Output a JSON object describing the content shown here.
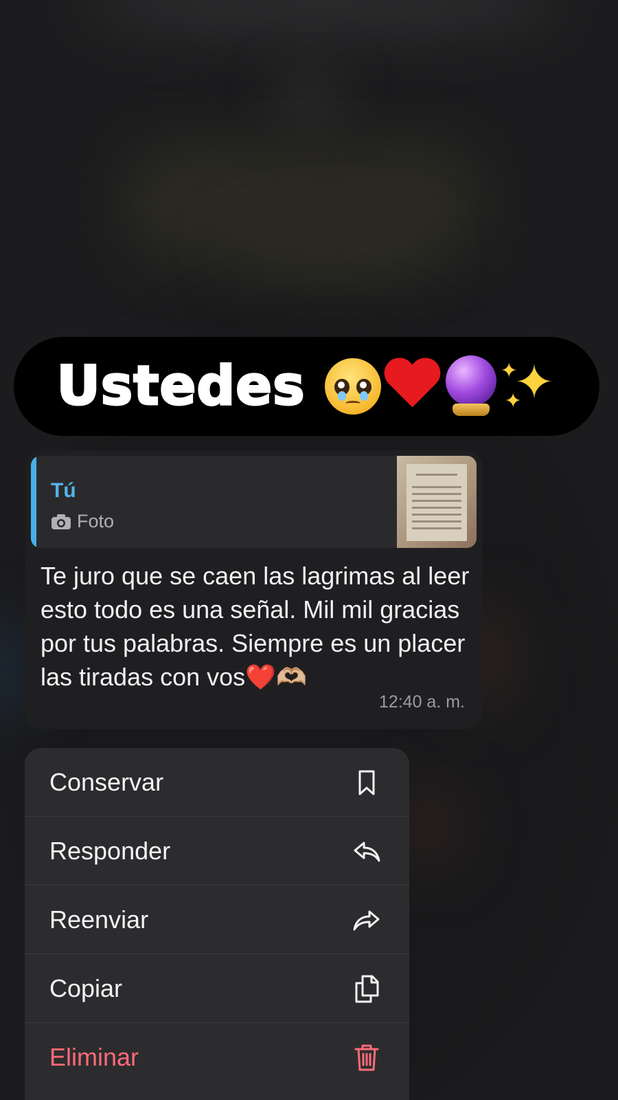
{
  "banner": {
    "text": "Ustedes",
    "emojis": [
      "pleading-face-icon",
      "red-heart-icon",
      "crystal-ball-icon",
      "sparkles-icon"
    ]
  },
  "message": {
    "quote": {
      "author": "Tú",
      "type_label": "Foto",
      "accent_color": "#4aaee8"
    },
    "text": "Te juro que se caen las lagrimas al leer esto todo es una señal. Mil mil gracias por tus palabras. Siempre es un placer las tiradas con vos❤️🫶🏼",
    "time": "12:40 a. m."
  },
  "menu": {
    "items": [
      {
        "label": "Conservar",
        "icon": "bookmark-icon"
      },
      {
        "label": "Responder",
        "icon": "reply-icon"
      },
      {
        "label": "Reenviar",
        "icon": "forward-icon"
      },
      {
        "label": "Copiar",
        "icon": "copy-icon"
      },
      {
        "label": "Eliminar",
        "icon": "trash-icon",
        "color": "#ff6b78"
      }
    ]
  }
}
